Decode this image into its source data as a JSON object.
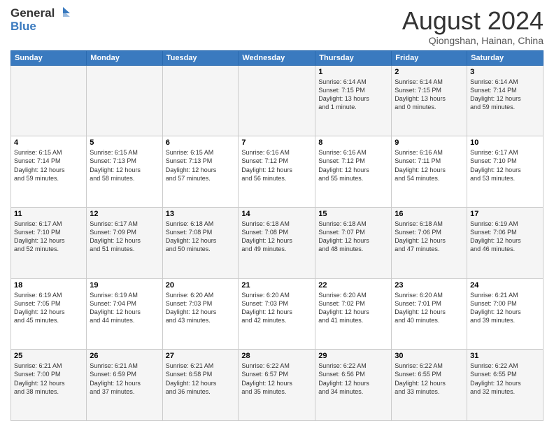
{
  "header": {
    "logo_general": "General",
    "logo_blue": "Blue",
    "month_title": "August 2024",
    "location": "Qiongshan, Hainan, China"
  },
  "days_of_week": [
    "Sunday",
    "Monday",
    "Tuesday",
    "Wednesday",
    "Thursday",
    "Friday",
    "Saturday"
  ],
  "weeks": [
    [
      {
        "day": "",
        "info": ""
      },
      {
        "day": "",
        "info": ""
      },
      {
        "day": "",
        "info": ""
      },
      {
        "day": "",
        "info": ""
      },
      {
        "day": "1",
        "info": "Sunrise: 6:14 AM\nSunset: 7:15 PM\nDaylight: 13 hours\nand 1 minute."
      },
      {
        "day": "2",
        "info": "Sunrise: 6:14 AM\nSunset: 7:15 PM\nDaylight: 13 hours\nand 0 minutes."
      },
      {
        "day": "3",
        "info": "Sunrise: 6:14 AM\nSunset: 7:14 PM\nDaylight: 12 hours\nand 59 minutes."
      }
    ],
    [
      {
        "day": "4",
        "info": "Sunrise: 6:15 AM\nSunset: 7:14 PM\nDaylight: 12 hours\nand 59 minutes."
      },
      {
        "day": "5",
        "info": "Sunrise: 6:15 AM\nSunset: 7:13 PM\nDaylight: 12 hours\nand 58 minutes."
      },
      {
        "day": "6",
        "info": "Sunrise: 6:15 AM\nSunset: 7:13 PM\nDaylight: 12 hours\nand 57 minutes."
      },
      {
        "day": "7",
        "info": "Sunrise: 6:16 AM\nSunset: 7:12 PM\nDaylight: 12 hours\nand 56 minutes."
      },
      {
        "day": "8",
        "info": "Sunrise: 6:16 AM\nSunset: 7:12 PM\nDaylight: 12 hours\nand 55 minutes."
      },
      {
        "day": "9",
        "info": "Sunrise: 6:16 AM\nSunset: 7:11 PM\nDaylight: 12 hours\nand 54 minutes."
      },
      {
        "day": "10",
        "info": "Sunrise: 6:17 AM\nSunset: 7:10 PM\nDaylight: 12 hours\nand 53 minutes."
      }
    ],
    [
      {
        "day": "11",
        "info": "Sunrise: 6:17 AM\nSunset: 7:10 PM\nDaylight: 12 hours\nand 52 minutes."
      },
      {
        "day": "12",
        "info": "Sunrise: 6:17 AM\nSunset: 7:09 PM\nDaylight: 12 hours\nand 51 minutes."
      },
      {
        "day": "13",
        "info": "Sunrise: 6:18 AM\nSunset: 7:08 PM\nDaylight: 12 hours\nand 50 minutes."
      },
      {
        "day": "14",
        "info": "Sunrise: 6:18 AM\nSunset: 7:08 PM\nDaylight: 12 hours\nand 49 minutes."
      },
      {
        "day": "15",
        "info": "Sunrise: 6:18 AM\nSunset: 7:07 PM\nDaylight: 12 hours\nand 48 minutes."
      },
      {
        "day": "16",
        "info": "Sunrise: 6:18 AM\nSunset: 7:06 PM\nDaylight: 12 hours\nand 47 minutes."
      },
      {
        "day": "17",
        "info": "Sunrise: 6:19 AM\nSunset: 7:06 PM\nDaylight: 12 hours\nand 46 minutes."
      }
    ],
    [
      {
        "day": "18",
        "info": "Sunrise: 6:19 AM\nSunset: 7:05 PM\nDaylight: 12 hours\nand 45 minutes."
      },
      {
        "day": "19",
        "info": "Sunrise: 6:19 AM\nSunset: 7:04 PM\nDaylight: 12 hours\nand 44 minutes."
      },
      {
        "day": "20",
        "info": "Sunrise: 6:20 AM\nSunset: 7:03 PM\nDaylight: 12 hours\nand 43 minutes."
      },
      {
        "day": "21",
        "info": "Sunrise: 6:20 AM\nSunset: 7:03 PM\nDaylight: 12 hours\nand 42 minutes."
      },
      {
        "day": "22",
        "info": "Sunrise: 6:20 AM\nSunset: 7:02 PM\nDaylight: 12 hours\nand 41 minutes."
      },
      {
        "day": "23",
        "info": "Sunrise: 6:20 AM\nSunset: 7:01 PM\nDaylight: 12 hours\nand 40 minutes."
      },
      {
        "day": "24",
        "info": "Sunrise: 6:21 AM\nSunset: 7:00 PM\nDaylight: 12 hours\nand 39 minutes."
      }
    ],
    [
      {
        "day": "25",
        "info": "Sunrise: 6:21 AM\nSunset: 7:00 PM\nDaylight: 12 hours\nand 38 minutes."
      },
      {
        "day": "26",
        "info": "Sunrise: 6:21 AM\nSunset: 6:59 PM\nDaylight: 12 hours\nand 37 minutes."
      },
      {
        "day": "27",
        "info": "Sunrise: 6:21 AM\nSunset: 6:58 PM\nDaylight: 12 hours\nand 36 minutes."
      },
      {
        "day": "28",
        "info": "Sunrise: 6:22 AM\nSunset: 6:57 PM\nDaylight: 12 hours\nand 35 minutes."
      },
      {
        "day": "29",
        "info": "Sunrise: 6:22 AM\nSunset: 6:56 PM\nDaylight: 12 hours\nand 34 minutes."
      },
      {
        "day": "30",
        "info": "Sunrise: 6:22 AM\nSunset: 6:55 PM\nDaylight: 12 hours\nand 33 minutes."
      },
      {
        "day": "31",
        "info": "Sunrise: 6:22 AM\nSunset: 6:55 PM\nDaylight: 12 hours\nand 32 minutes."
      }
    ]
  ]
}
